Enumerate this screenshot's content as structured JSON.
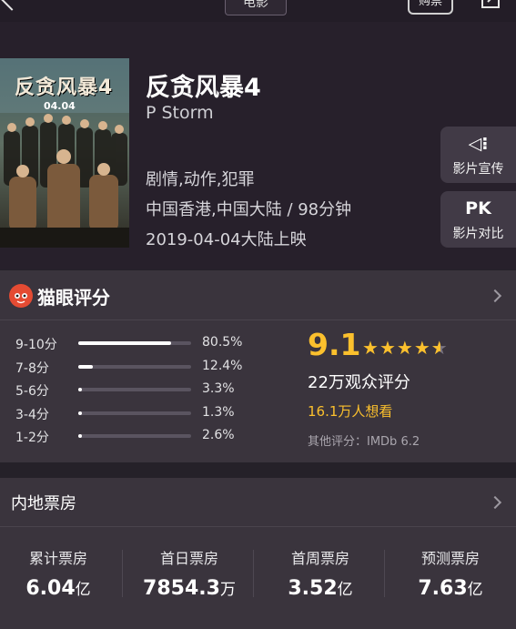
{
  "topbar": {
    "title": "电影",
    "buy_label": "购票"
  },
  "movie": {
    "title": "反贪风暴4",
    "english_title": "P Storm",
    "genres": "剧情,动作,犯罪",
    "region_duration": "中国香港,中国大陆 / 98分钟",
    "release": "2019-04-04大陆上映"
  },
  "poster": {
    "title_text": "反贪风暴4",
    "date_text": "04.04"
  },
  "side_buttons": {
    "promo": {
      "icon": "speaker-icon",
      "icon_text": "◁⁝",
      "label": "影片宣传"
    },
    "pk": {
      "icon_text": "PK",
      "label": "影片对比"
    }
  },
  "rating": {
    "title": "猫眼评分",
    "score": "9.1",
    "star_rating": 4.55,
    "audience": "22万观众评分",
    "wish": "16.1万人想看",
    "other": "其他评分：IMDb 6.2",
    "distribution": [
      {
        "label": "9-10分",
        "pct": "80.5%",
        "value": 0.805
      },
      {
        "label": "7-8分",
        "pct": "12.4%",
        "value": 0.124
      },
      {
        "label": "5-6分",
        "pct": "3.3%",
        "value": 0.033
      },
      {
        "label": "3-4分",
        "pct": "1.3%",
        "value": 0.013
      },
      {
        "label": "1-2分",
        "pct": "2.6%",
        "value": 0.026
      }
    ]
  },
  "box_office": {
    "title": "内地票房",
    "items": [
      {
        "label": "累计票房",
        "value": "6.04",
        "unit": "亿"
      },
      {
        "label": "首日票房",
        "value": "7854.3",
        "unit": "万"
      },
      {
        "label": "首周票房",
        "value": "3.52",
        "unit": "亿"
      },
      {
        "label": "预测票房",
        "value": "7.63",
        "unit": "亿"
      }
    ]
  },
  "colors": {
    "accent": "#fbc02d",
    "logo": "#e44b33",
    "background": "#252129",
    "panel": "#3a343d"
  }
}
